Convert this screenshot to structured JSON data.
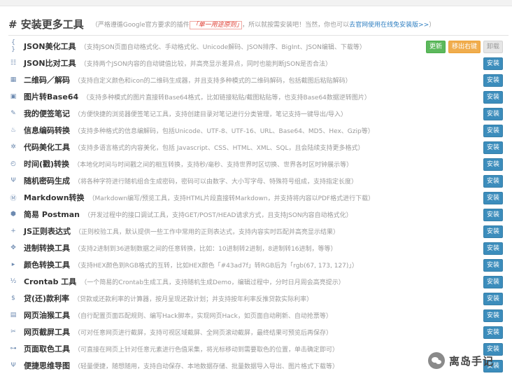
{
  "header": {
    "title": "# 安装更多工具",
    "note_prefix": "（严格遵循Google官方要求的插件",
    "notice": "「单一用途原则」",
    "note_middle": "，所以就按需安装吧！当然，你也可以",
    "link": "去官网使用在线免安装版>>",
    "note_suffix": "）"
  },
  "buttons": {
    "install": "安装",
    "update": "更新",
    "pin": "移出右键",
    "uninstall": "卸载"
  },
  "tools": [
    {
      "icon": "{ }",
      "icon_name": "json-format-icon",
      "name": "JSON美化工具",
      "desc": "（支持JSON页面自动格式化、手动格式化、Unicode解码、JSON排序、BigInt、JSON编辑、下载等）",
      "installed": true
    },
    {
      "icon": "☷",
      "icon_name": "json-compare-icon",
      "name": "JSON比对工具",
      "desc": "（支持两个JSON内容的自动键值比较，并高亮显示差异点，同时也能判断JSON是否合法）",
      "installed": false
    },
    {
      "icon": "▦",
      "icon_name": "qrcode-icon",
      "name": "二维码／解码",
      "desc": "（支持自定义颜色和icon的二维码生成器，并且支持多种模式的二维码解码，包括截图后粘贴解码）",
      "installed": false
    },
    {
      "icon": "▣",
      "icon_name": "image-icon",
      "name": "图片转Base64",
      "desc": "（支持多种模式的图片直接转Base64格式，比如链接粘贴/截图粘贴等，也支持Base64数据逆转图片）",
      "installed": false
    },
    {
      "icon": "✎",
      "icon_name": "pencil-icon",
      "name": "我的便签笔记",
      "desc": "（方便快捷的浏览器便签笔记工具，支持创建目录对笔记进行分类管理，笔记支持一键导出/导入）",
      "installed": false
    },
    {
      "icon": "♨",
      "icon_name": "encode-icon",
      "name": "信息编码转换",
      "desc": "（支持多种格式的信息编解码，包括Unicode、UTF-8、UTF-16、URL、Base64、MD5、Hex、Gzip等）",
      "installed": false
    },
    {
      "icon": "✲",
      "icon_name": "code-beautify-icon",
      "name": "代码美化工具",
      "desc": "（支持多语言格式的内容美化，包括 Javascript、CSS、HTML、XML、SQL，且会陆续支持更多格式）",
      "installed": false
    },
    {
      "icon": "◴",
      "icon_name": "clock-icon",
      "name": "时间(戳)转换",
      "desc": "（本地化时间与时间戳之间的相互转换，支持秒/毫秒、支持世界时区切换、世界各时区时钟展示等）",
      "installed": false
    },
    {
      "icon": "Ψ",
      "icon_name": "password-icon",
      "name": "随机密码生成",
      "desc": "（将各种字符进行随机组合生成密码，密码可以由数字、大小写字母、特殊符号组成，支持指定长度）",
      "installed": false
    },
    {
      "icon": "Ⓜ",
      "icon_name": "markdown-icon",
      "name": "Markdown转换",
      "desc": "（Markdown编写/预览工具，支持HTML片段直接转Markdown，并支持将内容以PDF格式进行下载）",
      "installed": false
    },
    {
      "icon": "⬢",
      "icon_name": "postman-icon",
      "name": "简易 Postman",
      "desc": "（开发过程中的接口调试工具，支持GET/POST/HEAD请求方式，且支持JSON内容自动格式化）",
      "installed": false
    },
    {
      "icon": "+",
      "icon_name": "regex-icon",
      "name": "JS正则表达式",
      "desc": "（正则校验工具，默认提供一些工作中常用的正则表达式，支持内容实时匹配并高亮显示结果）",
      "installed": false
    },
    {
      "icon": "✥",
      "icon_name": "radix-icon",
      "name": "进制转换工具",
      "desc": "（支持2进制到36进制数据之间的任意转换，比如：10进制转2进制，8进制转16进制，等等）",
      "installed": false
    },
    {
      "icon": "▸",
      "icon_name": "color-convert-icon",
      "name": "颜色转换工具",
      "desc": "（支持HEX颜色到RGB格式的互转，比如HEX颜色「#43ad7f」转RGB后为「rgb(67, 173, 127)」）",
      "installed": false
    },
    {
      "icon": "½",
      "icon_name": "crontab-icon",
      "name": "Crontab 工具",
      "desc": "（一个简易的Crontab生成工具，支持随机生成Demo，编辑过程中，分时日月周会高亮提示）",
      "installed": false
    },
    {
      "icon": "$",
      "icon_name": "loan-icon",
      "name": "贷(还)款利率",
      "desc": "（贷款或还款利率的计算器，按月呈现还款计划；并支持按年利率反推贷款实际利率）",
      "installed": false
    },
    {
      "icon": "▤",
      "icon_name": "grease-icon",
      "name": "网页油猴工具",
      "desc": "（自行配置页面匹配规则、编写Hack脚本，实现网页Hack，如页面自动刷新、自动抢票等）",
      "installed": false
    },
    {
      "icon": "✂",
      "icon_name": "scissors-icon",
      "name": "网页截屏工具",
      "desc": "（可对任意网页进行截屏，支持可视区域截屏、全网页滚动截屏，最终结果可预览后再保存）",
      "installed": false
    },
    {
      "icon": "⊶",
      "icon_name": "color-picker-icon",
      "name": "页面取色工具",
      "desc": "（可直接在网页上针对任意元素进行色值采集，将光标移动到需要取色的位置，单击确定即可）",
      "installed": false
    },
    {
      "icon": "Ψ",
      "icon_name": "mindmap-icon",
      "name": "便捷思维导图",
      "desc": "（轻量便捷，随想随用，支持自动保存、本地数据存储、批量数据导入导出、图片格式下载等）",
      "installed": false
    }
  ],
  "watermark": {
    "text": "离岛手记"
  }
}
